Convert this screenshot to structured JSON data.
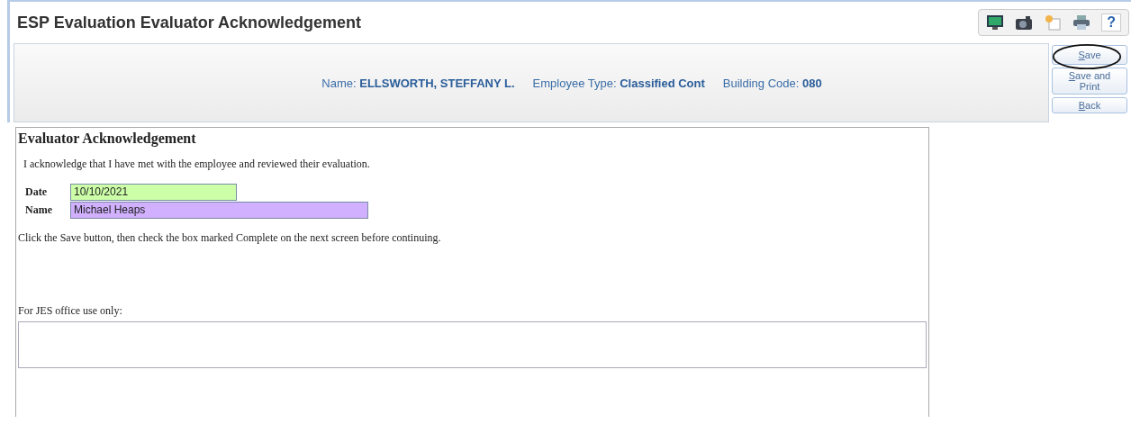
{
  "window": {
    "title": "ESP Evaluation Evaluator Acknowledgement"
  },
  "toolbar": {
    "help": "?"
  },
  "header": {
    "fields": [
      "Name: **ELLSWORTH, STEFFANY L.**",
      "Employee Type: **Classified Cont**",
      "Building Code: **080**"
    ]
  },
  "actions": [
    {
      "label": "Save",
      "circled": true
    },
    {
      "label": "Save and Print",
      "circled": false
    },
    {
      "label": "Back",
      "circled": false
    }
  ],
  "form": {
    "title": "Evaluator Acknowledgement",
    "statement": "I acknowledge that I have met with the employee and reviewed their evaluation.",
    "fields": [
      {
        "label": "Date",
        "value": "10/10/2021",
        "color": "#ccffa8"
      },
      {
        "label": "Name",
        "value": "Michael Heaps",
        "color": "#d0b0ff"
      }
    ],
    "instruction": "Click the Save button, then check the box marked Complete on the next screen before continuing.",
    "notes_label": "For JES office use only:"
  }
}
